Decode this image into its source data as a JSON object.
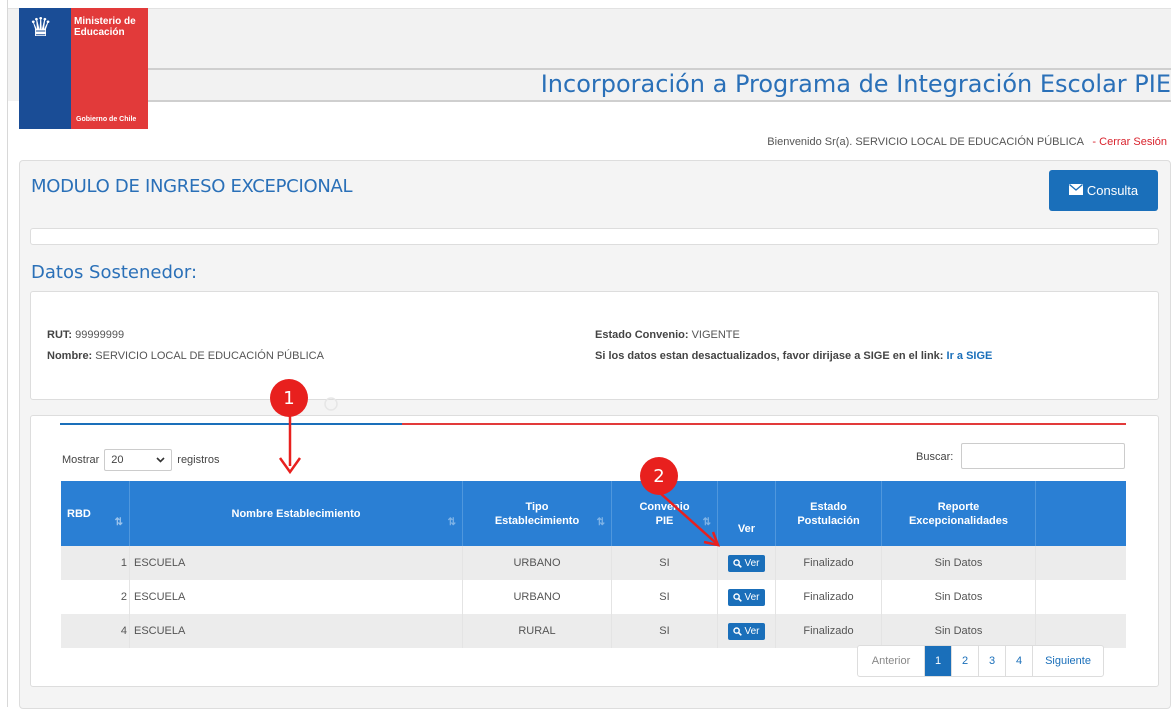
{
  "logo": {
    "ministry_line1": "Ministerio de",
    "ministry_line2": "Educación",
    "government": "Gobierno de Chile"
  },
  "header": {
    "app_title": "Incorporación a Programa de Integración Escolar PIE",
    "welcome": "Bienvenido Sr(a). SERVICIO LOCAL DE EDUCACIÓN PÚBLICA",
    "logout": "- Cerrar Sesión"
  },
  "module": {
    "title": "MODULO DE INGRESO EXCEPCIONAL",
    "consulta_label": "Consulta"
  },
  "sostenedor": {
    "section_title": "Datos Sostenedor:",
    "rut_label": "RUT:",
    "rut_value": "99999999",
    "nombre_label": "Nombre:",
    "nombre_value": "SERVICIO LOCAL DE EDUCACIÓN PÚBLICA",
    "estado_label": "Estado Convenio:",
    "estado_value": "VIGENTE",
    "notice": "Si los datos estan desactualizados, favor dirijase a SIGE en el link:",
    "sige_link": "Ir a SIGE"
  },
  "table_controls": {
    "mostrar": "Mostrar",
    "page_size": "20",
    "registros": "registros",
    "buscar": "Buscar:"
  },
  "table": {
    "headers": {
      "rbd": "RBD",
      "nombre": "Nombre Establecimiento",
      "tipo_1": "Tipo",
      "tipo_2": "Establecimiento",
      "convenio_1": "Convenio",
      "convenio_2": "PIE",
      "ver": "Ver",
      "estado_1": "Estado",
      "estado_2": "Postulación",
      "reporte_1": "Reporte",
      "reporte_2": "Excepcionalidades"
    },
    "rows": [
      {
        "rbd": "1",
        "nombre": "ESCUELA",
        "tipo": "URBANO",
        "convenio": "SI",
        "ver": "Ver",
        "estado": "Finalizado",
        "reporte": "Sin Datos"
      },
      {
        "rbd": "2",
        "nombre": "ESCUELA",
        "tipo": "URBANO",
        "convenio": "SI",
        "ver": "Ver",
        "estado": "Finalizado",
        "reporte": "Sin Datos"
      },
      {
        "rbd": "4",
        "nombre": "ESCUELA",
        "tipo": "RURAL",
        "convenio": "SI",
        "ver": "Ver",
        "estado": "Finalizado",
        "reporte": "Sin Datos"
      }
    ]
  },
  "pagination": {
    "prev": "Anterior",
    "pages": [
      "1",
      "2",
      "3",
      "4"
    ],
    "current": "1",
    "next": "Siguiente"
  },
  "annotations": {
    "callout_1": "1",
    "callout_2": "2"
  },
  "colors": {
    "primary_blue": "#1a6fba",
    "header_blue": "#2a7fd4",
    "brand_red": "#e23a3a",
    "callout_red": "#e8201e"
  }
}
